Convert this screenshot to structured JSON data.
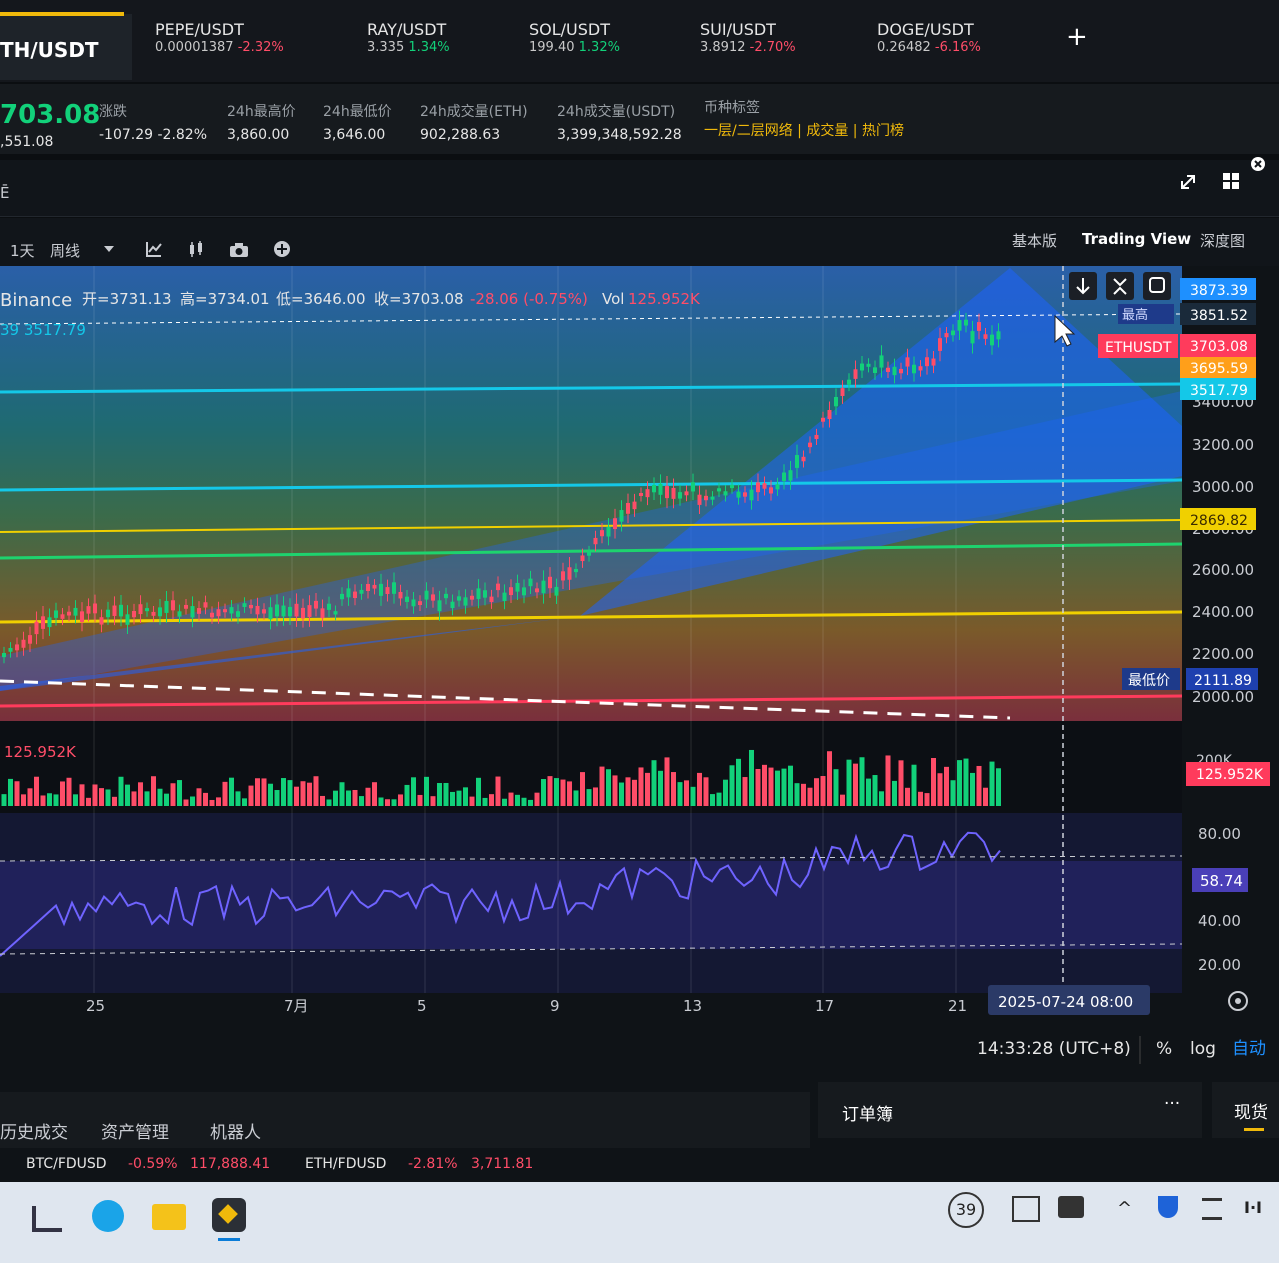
{
  "tabs": {
    "active": "TH/USDT",
    "items": [
      {
        "pair": "PEPE/USDT",
        "price": "0.00001387",
        "change": "-2.32%",
        "dir": "down"
      },
      {
        "pair": "RAY/USDT",
        "price": "3.335",
        "change": "1.34%",
        "dir": "up"
      },
      {
        "pair": "SOL/USDT",
        "price": "199.40",
        "change": "1.32%",
        "dir": "up"
      },
      {
        "pair": "SUI/USDT",
        "price": "3.8912",
        "change": "-2.70%",
        "dir": "down"
      },
      {
        "pair": "DOGE/USDT",
        "price": "0.26482",
        "change": "-6.16%",
        "dir": "down"
      }
    ],
    "add": "+"
  },
  "stats": {
    "price": "703.08",
    "price_sub": ",551.08",
    "change_label": "涨跌",
    "change_value": "-107.29 -2.82%",
    "high_label": "24h最高价",
    "high_value": "3,860.00",
    "low_label": "24h最低价",
    "low_value": "3,646.00",
    "vol_eth_label": "24h成交量(ETH)",
    "vol_eth_value": "902,288.63",
    "vol_usdt_label": "24h成交量(USDT)",
    "vol_usdt_value": "3,399,348,592.28",
    "tag_label": "币种标签",
    "tags": "一层/二层网络 | 成交量 | 热门榜"
  },
  "toolbar": {
    "title_char": "Ē",
    "interval": "1天",
    "weekly": "周线",
    "views": [
      "基本版",
      "Trading View",
      "深度图"
    ]
  },
  "ohlc": {
    "source": "Binance",
    "open": "开=3731.13",
    "high": "高=3734.01",
    "low": "低=3646.00",
    "close": "收=3703.08",
    "change": "-28.06 (-0.75%)",
    "vol_label": "Vol",
    "vol_value": "125.952K",
    "ind_value": "39 3517.79"
  },
  "axis": {
    "price_ticks": [
      "3400.00",
      "3200.00",
      "3000.00",
      "2800.00",
      "2600.00",
      "2400.00",
      "2200.00",
      "2000.00"
    ],
    "labels": {
      "top1": "3873.39",
      "top2": "3851.52",
      "top2_tag": "最高",
      "current": "3703.08",
      "current_tag": "ETHUSDT",
      "ma": "3695.59",
      "cyan": "3517.79",
      "yellow": "2869.82",
      "low": "2111.89",
      "low_tag": "最低价"
    },
    "vol_ticks": [
      "200K"
    ],
    "vol_current": "125.952K",
    "vol_label": "125.952K",
    "rsi_ticks": [
      "80.00",
      "40.00",
      "20.00"
    ],
    "rsi_current": "58.74",
    "date_ticks": [
      "25",
      "7月",
      "5",
      "9",
      "13",
      "17",
      "21"
    ],
    "crosshair_date": "2025-07-24  08:00",
    "clock": "14:33:28 (UTC+8)",
    "pct": "%",
    "log": "log",
    "auto": "自动"
  },
  "bottom": {
    "tabs": [
      "历史成交",
      "资产管理",
      "机器人"
    ],
    "orderbook": "订单簿",
    "more": "···",
    "spot": "现货",
    "ticker1_pair": "BTC/FDUSD",
    "ticker1_change": "-0.59%",
    "ticker1_price": "117,888.41",
    "ticker2_pair": "ETH/FDUSD",
    "ticker2_change": "-2.81%",
    "ticker2_price": "3,711.81"
  },
  "taskbar": {
    "notif_count": "39"
  },
  "colors": {
    "up": "#12d17a",
    "down": "#ff4d68",
    "cyan": "#14c8e8",
    "yellow": "#f0d000",
    "blue_band": "#1e63ff",
    "accent": "#f0b90b"
  }
}
